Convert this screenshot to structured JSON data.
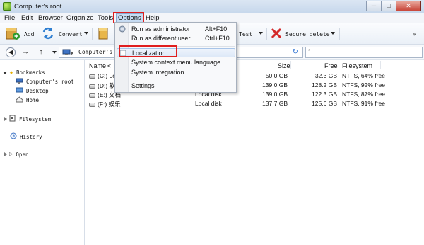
{
  "window": {
    "title": "Computer's root",
    "minimize": "─",
    "maximize": "□",
    "close": "✕"
  },
  "menubar": [
    "File",
    "Edit",
    "Browser",
    "Organize",
    "Tools",
    "Options",
    "Help"
  ],
  "toolbar": {
    "add": "Add",
    "convert": "Convert",
    "test": "Test",
    "secure_delete": "Secure delete"
  },
  "address": {
    "path": "Computer's ro"
  },
  "sidebar": {
    "bookmarks": "Bookmarks",
    "items": [
      "Computer's root",
      "Desktop",
      "Home"
    ],
    "filesystem": "Filesystem",
    "history": "History",
    "open": "Open"
  },
  "table": {
    "headers": {
      "name": "Name",
      "size": "Size",
      "free": "Free",
      "filesystem": "Filesystem"
    },
    "rows": [
      {
        "name": "(C:) Lo",
        "type": "",
        "size": "50.0 GB",
        "free": "32.3 GB",
        "fs": "NTFS, 64% free"
      },
      {
        "name": "(D:) 软",
        "type": "",
        "size": "139.0 GB",
        "free": "128.2 GB",
        "fs": "NTFS, 92% free"
      },
      {
        "name": "(E:) 文档",
        "type": "Local disk",
        "size": "139.0 GB",
        "free": "122.3 GB",
        "fs": "NTFS, 87% free"
      },
      {
        "name": "(F:) 娱乐",
        "type": "Local disk",
        "size": "137.7 GB",
        "free": "125.6 GB",
        "fs": "NTFS, 91% free"
      }
    ]
  },
  "options_menu": {
    "run_admin": "Run as administrator",
    "run_admin_shortcut": "Alt+F10",
    "run_different": "Run as different user",
    "run_different_shortcut": "Ctrl+F10",
    "localization": "Localization",
    "context_menu_language": "System context menu language",
    "system_integration": "System integration",
    "settings": "Settings"
  },
  "colors": {
    "highlight_box": "#e01e1e",
    "accent": "#3a7bd5"
  }
}
